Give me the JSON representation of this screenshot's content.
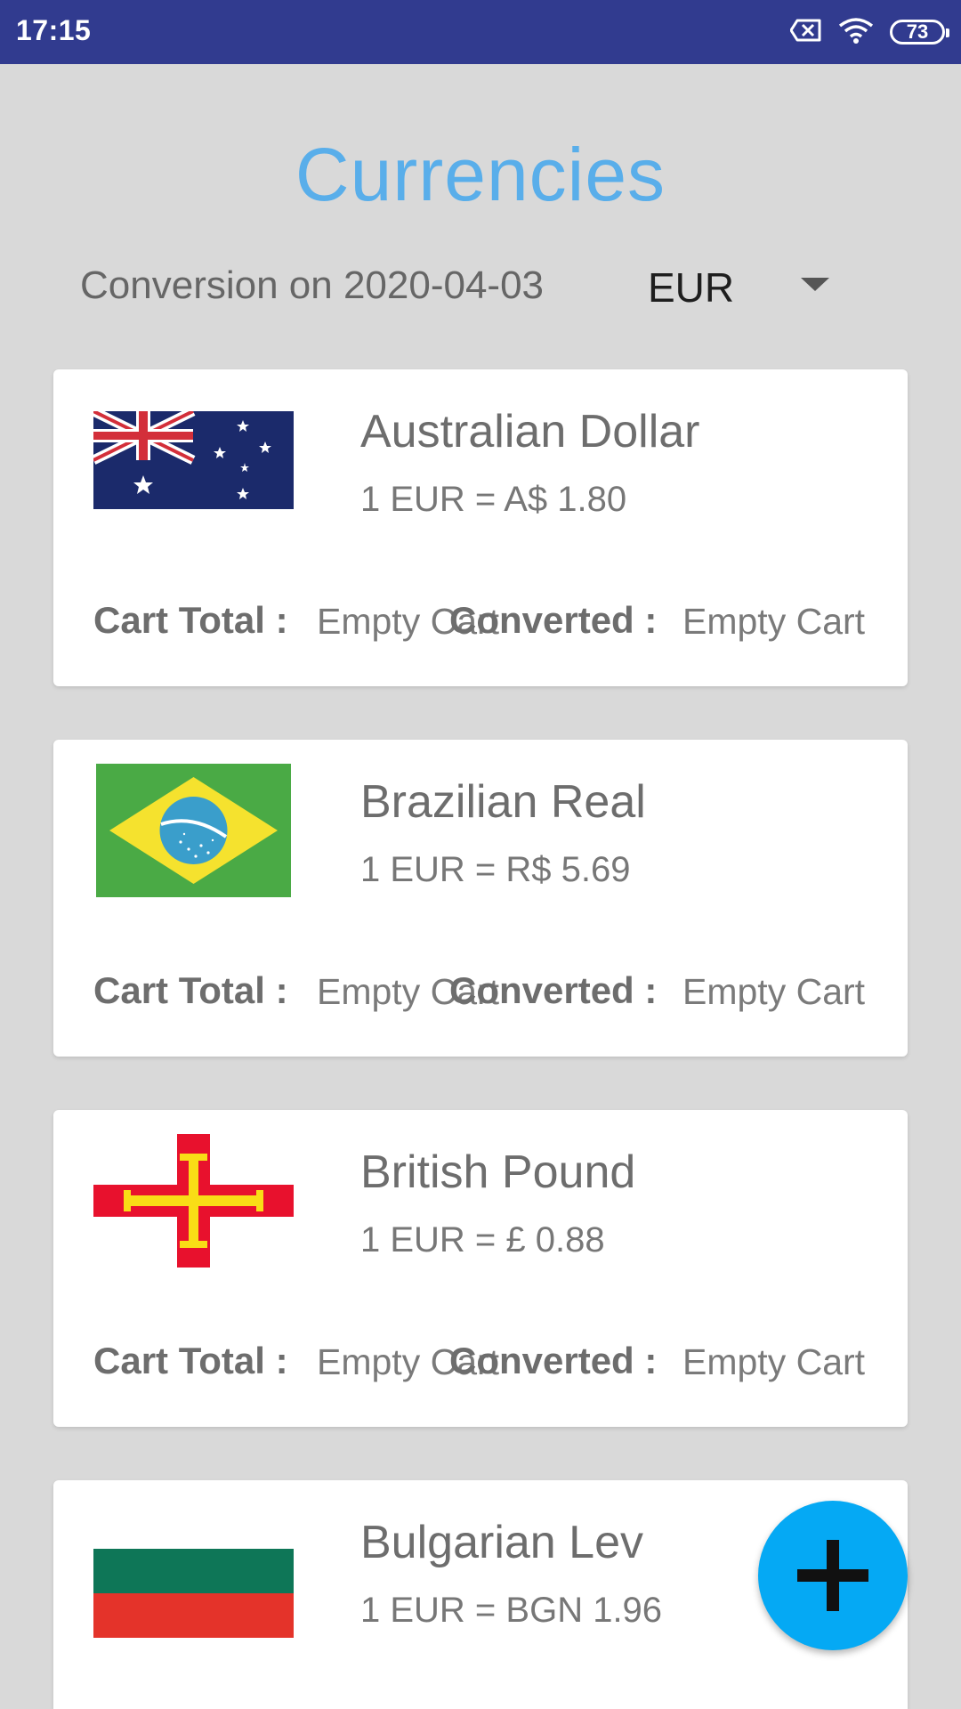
{
  "status_bar": {
    "time": "17:15",
    "battery": "73",
    "icons": [
      "notification-x-icon",
      "wifi-icon",
      "battery-icon"
    ]
  },
  "header": {
    "title": "Currencies"
  },
  "conversion": {
    "label": "Conversion on 2020-04-03",
    "selected_currency": "EUR"
  },
  "currencies": [
    {
      "name": "Australian Dollar",
      "rate": "1 EUR = A$  1.80",
      "flag": "australia-flag",
      "cart_total_label": "Cart Total :",
      "cart_total_value": "Empty Cart",
      "converted_label": "Converted :",
      "converted_value": "Empty Cart"
    },
    {
      "name": "Brazilian Real",
      "rate": "1 EUR = R$  5.69",
      "flag": "brazil-flag",
      "cart_total_label": "Cart Total :",
      "cart_total_value": "Empty Cart",
      "converted_label": "Converted :",
      "converted_value": "Empty Cart"
    },
    {
      "name": "British Pound",
      "rate": "1 EUR = £  0.88",
      "flag": "guernsey-flag",
      "cart_total_label": "Cart Total :",
      "cart_total_value": "Empty Cart",
      "converted_label": "Converted :",
      "converted_value": "Empty Cart"
    },
    {
      "name": "Bulgarian Lev",
      "rate": "1 EUR = BGN  1.96",
      "flag": "bulgaria-flag"
    }
  ],
  "fab": {
    "icon": "plus-icon"
  },
  "colors": {
    "status_bar": "#313b8f",
    "title": "#59aeea",
    "background": "#d9d9d9",
    "fab": "#05a9f4"
  }
}
